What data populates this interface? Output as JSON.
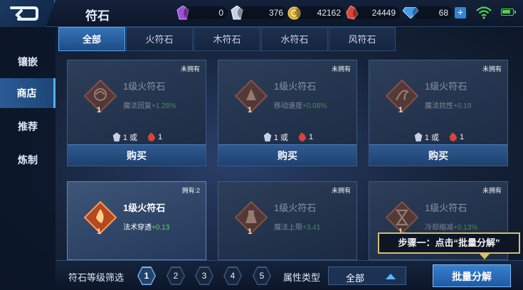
{
  "header": {
    "title": "符石",
    "resources": [
      {
        "icon": "purple-crystal-icon",
        "value": "0"
      },
      {
        "icon": "silver-crystal-icon",
        "value": "376"
      },
      {
        "icon": "gold-coin-icon",
        "value": "42162"
      },
      {
        "icon": "red-crystal-icon",
        "value": "24449"
      },
      {
        "icon": "diamond-icon",
        "value": "68"
      }
    ],
    "add_label": "+"
  },
  "sidebar": {
    "items": [
      {
        "label": "镶嵌",
        "active": false
      },
      {
        "label": "商店",
        "active": true
      },
      {
        "label": "推荐",
        "active": false
      },
      {
        "label": "炼制",
        "active": false
      }
    ]
  },
  "tabs": [
    {
      "label": "全部",
      "active": true
    },
    {
      "label": "火符石",
      "active": false
    },
    {
      "label": "木符石",
      "active": false
    },
    {
      "label": "水符石",
      "active": false
    },
    {
      "label": "风符石",
      "active": false
    }
  ],
  "cards": [
    {
      "status": "未拥有",
      "name": "1级火符石",
      "attr": "魔法回复",
      "bonus": "+1.28%",
      "level": "1",
      "cost_a": "1 或",
      "cost_b": "1",
      "buy": "购买"
    },
    {
      "status": "未拥有",
      "name": "1级火符石",
      "attr": "移动速度",
      "bonus": "+0.08%",
      "level": "1",
      "cost_a": "1 或",
      "cost_b": "1",
      "buy": "购买"
    },
    {
      "status": "未拥有",
      "name": "1级火符石",
      "attr": "魔法抗性",
      "bonus": "+0.19",
      "level": "1",
      "cost_a": "1 或",
      "cost_b": "1",
      "buy": "购买"
    },
    {
      "status": "拥有:2",
      "name": "1级火符石",
      "attr": "法术穿透",
      "bonus": "+0.13",
      "level": "1"
    },
    {
      "status": "未拥有",
      "name": "1级火符石",
      "attr": "魔法上限",
      "bonus": "+3.41",
      "level": "1"
    },
    {
      "status": "未拥有",
      "name": "1级火符石",
      "attr": "冷却缩减",
      "bonus": "+0.13%",
      "level": "1"
    }
  ],
  "filter": {
    "level_label": "符石等级筛选",
    "levels": [
      "1",
      "2",
      "3",
      "4",
      "5"
    ],
    "active_level": "1",
    "type_label": "属性类型",
    "type_value": "全部",
    "batch_label": "批量分解"
  },
  "tooltip": {
    "text": "步骤一：点击“批量分解”"
  },
  "colors": {
    "accent": "#3a7fd0",
    "bonus_green": "#5fd45a",
    "tooltip_border": "#d7be6d"
  }
}
